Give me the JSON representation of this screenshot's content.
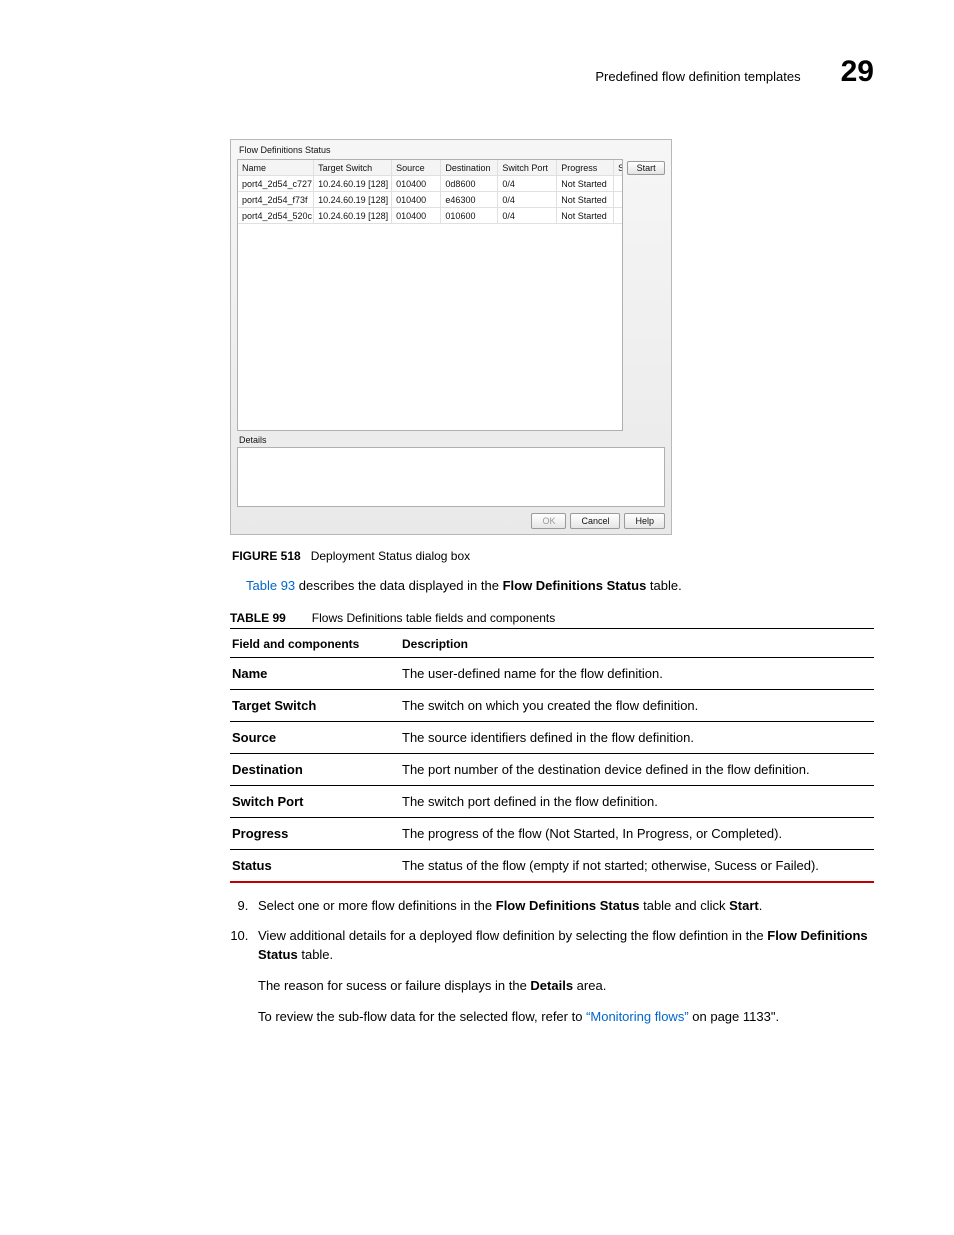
{
  "header": {
    "title": "Predefined flow definition templates",
    "chapter": "29"
  },
  "dialog": {
    "panel_title": "Flow Definitions Status",
    "columns": {
      "name": "Name",
      "target_switch": "Target Switch",
      "source": "Source",
      "destination": "Destination",
      "switch_port": "Switch Port",
      "progress": "Progress",
      "status": "Status"
    },
    "rows": [
      {
        "name": "port4_2d54_c727",
        "tsw": "10.24.60.19 [128]",
        "src": "010400",
        "dst": "0d8600",
        "spt": "0/4",
        "prg": "Not Started",
        "sts": ""
      },
      {
        "name": "port4_2d54_f73f",
        "tsw": "10.24.60.19 [128]",
        "src": "010400",
        "dst": "e46300",
        "spt": "0/4",
        "prg": "Not Started",
        "sts": ""
      },
      {
        "name": "port4_2d54_520c",
        "tsw": "10.24.60.19 [128]",
        "src": "010400",
        "dst": "010600",
        "spt": "0/4",
        "prg": "Not Started",
        "sts": ""
      }
    ],
    "start_label": "Start",
    "details_label": "Details",
    "btn_ok": "OK",
    "btn_cancel": "Cancel",
    "btn_help": "Help"
  },
  "figure": {
    "num": "FIGURE 518",
    "caption": "Deployment Status dialog box"
  },
  "intro": {
    "link": "Table 93",
    "pre": " describes the data displayed in the ",
    "bold": "Flow Definitions Status",
    "post": " table."
  },
  "table99": {
    "num": "TABLE 99",
    "title": "Flows Definitions table fields and components",
    "head_field": "Field and components",
    "head_desc": "Description",
    "rows": [
      {
        "f": "Name",
        "d": "The user-defined name for the flow definition."
      },
      {
        "f": "Target Switch",
        "d": "The switch on which you created the flow definition."
      },
      {
        "f": "Source",
        "d": "The source identifiers defined in the flow definition."
      },
      {
        "f": "Destination",
        "d": "The port number of the destination device defined in the flow definition."
      },
      {
        "f": "Switch Port",
        "d": "The switch port defined in the flow definition."
      },
      {
        "f": "Progress",
        "d": "The progress of the flow (Not Started, In Progress, or Completed)."
      },
      {
        "f": "Status",
        "d": "The status of the flow (empty if not started; otherwise, Sucess or Failed)."
      }
    ]
  },
  "steps": {
    "s9": {
      "pre": "Select one or more flow definitions in the ",
      "b1": "Flow Definitions Status",
      "mid": " table and click ",
      "b2": "Start",
      "post": "."
    },
    "s10": {
      "pre": "View additional details for a deployed flow definition by selecting the flow defintion in the ",
      "b1": "Flow Definitions Status",
      "post": " table."
    },
    "p1": {
      "pre": "The reason for sucess or failure displays in the ",
      "b": "Details",
      "post": " area."
    },
    "p2": {
      "pre": "To review the sub-flow data for the selected flow, refer to ",
      "link": "“Monitoring flows”",
      "post": " on page 1133\"."
    }
  }
}
